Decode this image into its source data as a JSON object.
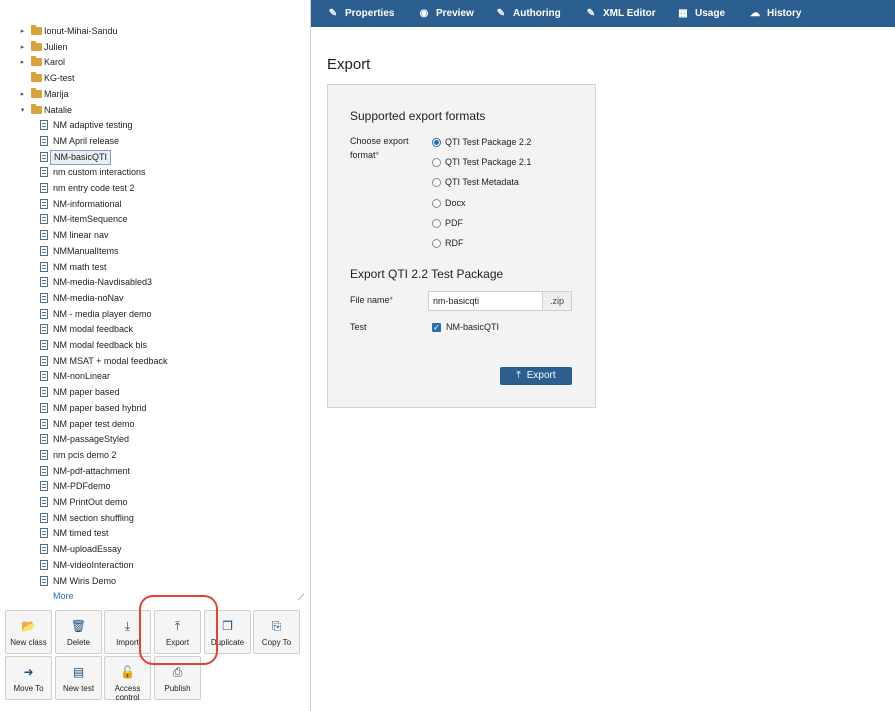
{
  "tree": {
    "folders": [
      {
        "label": "Ionut-Mihai-Sandu",
        "arrow": "▸"
      },
      {
        "label": "Julien",
        "arrow": "▸"
      },
      {
        "label": "Karol",
        "arrow": "▸"
      },
      {
        "label": "KG-test",
        "arrow": ""
      },
      {
        "label": "Marija",
        "arrow": "▸"
      },
      {
        "label": "Natalie",
        "arrow": "▾"
      }
    ],
    "items": [
      "NM adaptive testing",
      "NM April release",
      "NM-basicQTI",
      "nm custom interactions",
      "nm entry code test 2",
      "NM-informational",
      "NM-itemSequence",
      "NM linear nav",
      "NMManualItems",
      "NM math test",
      "NM-media-Navdisabled3",
      "NM-media-noNav",
      "NM - media player demo",
      "NM modal feedback",
      "NM modal feedback bis",
      "NM MSAT + modal feedback",
      "NM-nonLinear",
      "NM paper based",
      "NM paper based hybrid",
      "NM paper test demo",
      "NM-passageStyled",
      "nm pcis demo 2",
      "NM-pdf-attachment",
      "NM-PDFdemo",
      "NM PrintOut demo",
      "NM section shuffling",
      "NM timed test",
      "NM-uploadEssay",
      "NM-videoInteraction",
      "NM Wiris Demo"
    ],
    "selected_item": "NM-basicQTI",
    "more_label": "More",
    "resize_glyph": "⟋"
  },
  "actions": [
    {
      "label": "New class",
      "icon": "folder-open-icon",
      "glyph": "📂"
    },
    {
      "label": "Delete",
      "icon": "trash-icon",
      "glyph": "🗑"
    },
    {
      "label": "Import",
      "icon": "import-icon",
      "glyph": "⤓"
    },
    {
      "label": "Export",
      "icon": "export-icon",
      "glyph": "⤒"
    },
    {
      "label": "Duplicate",
      "icon": "duplicate-icon",
      "glyph": "❐"
    },
    {
      "label": "Copy To",
      "icon": "copy-to-icon",
      "glyph": "⎘"
    },
    {
      "label": "Move To",
      "icon": "move-to-icon",
      "glyph": "➜"
    },
    {
      "label": "New test",
      "icon": "new-test-icon",
      "glyph": "▤"
    },
    {
      "label": "Access control",
      "icon": "lock-icon",
      "glyph": "🔓"
    },
    {
      "label": "Publish",
      "icon": "publish-icon",
      "glyph": "⎙"
    }
  ],
  "nav": [
    {
      "label": "Properties",
      "icon": "pencil-icon",
      "glyph": "✎"
    },
    {
      "label": "Preview",
      "icon": "eye-icon",
      "glyph": "◉"
    },
    {
      "label": "Authoring",
      "icon": "pencil-icon",
      "glyph": "✎"
    },
    {
      "label": "XML Editor",
      "icon": "pencil-icon",
      "glyph": "✎"
    },
    {
      "label": "Usage",
      "icon": "usage-icon",
      "glyph": "▦"
    },
    {
      "label": "History",
      "icon": "history-icon",
      "glyph": "☁"
    }
  ],
  "main": {
    "title": "Export",
    "panel": {
      "heading": "Supported export formats",
      "format_label": "Choose export format",
      "required_mark": "*",
      "formats": [
        {
          "label": "QTI Test Package 2.2",
          "checked": true
        },
        {
          "label": "QTI Test Package 2.1",
          "checked": false
        },
        {
          "label": "QTI Test Metadata",
          "checked": false
        },
        {
          "label": "Docx",
          "checked": false
        },
        {
          "label": "PDF",
          "checked": false
        },
        {
          "label": "RDF",
          "checked": false
        }
      ],
      "package_heading": "Export QTI 2.2 Test Package",
      "filename_label": "File name",
      "filename_value": "nm-basicqti",
      "filename_ext": ".zip",
      "test_label": "Test",
      "test_option": "NM-basicQTI",
      "test_checked": true,
      "submit_label": "Export",
      "submit_icon": "export-icon"
    }
  },
  "colors": {
    "topbar": "#2b5f90",
    "highlight": "#e5413a",
    "folder": "#d9a33a"
  }
}
